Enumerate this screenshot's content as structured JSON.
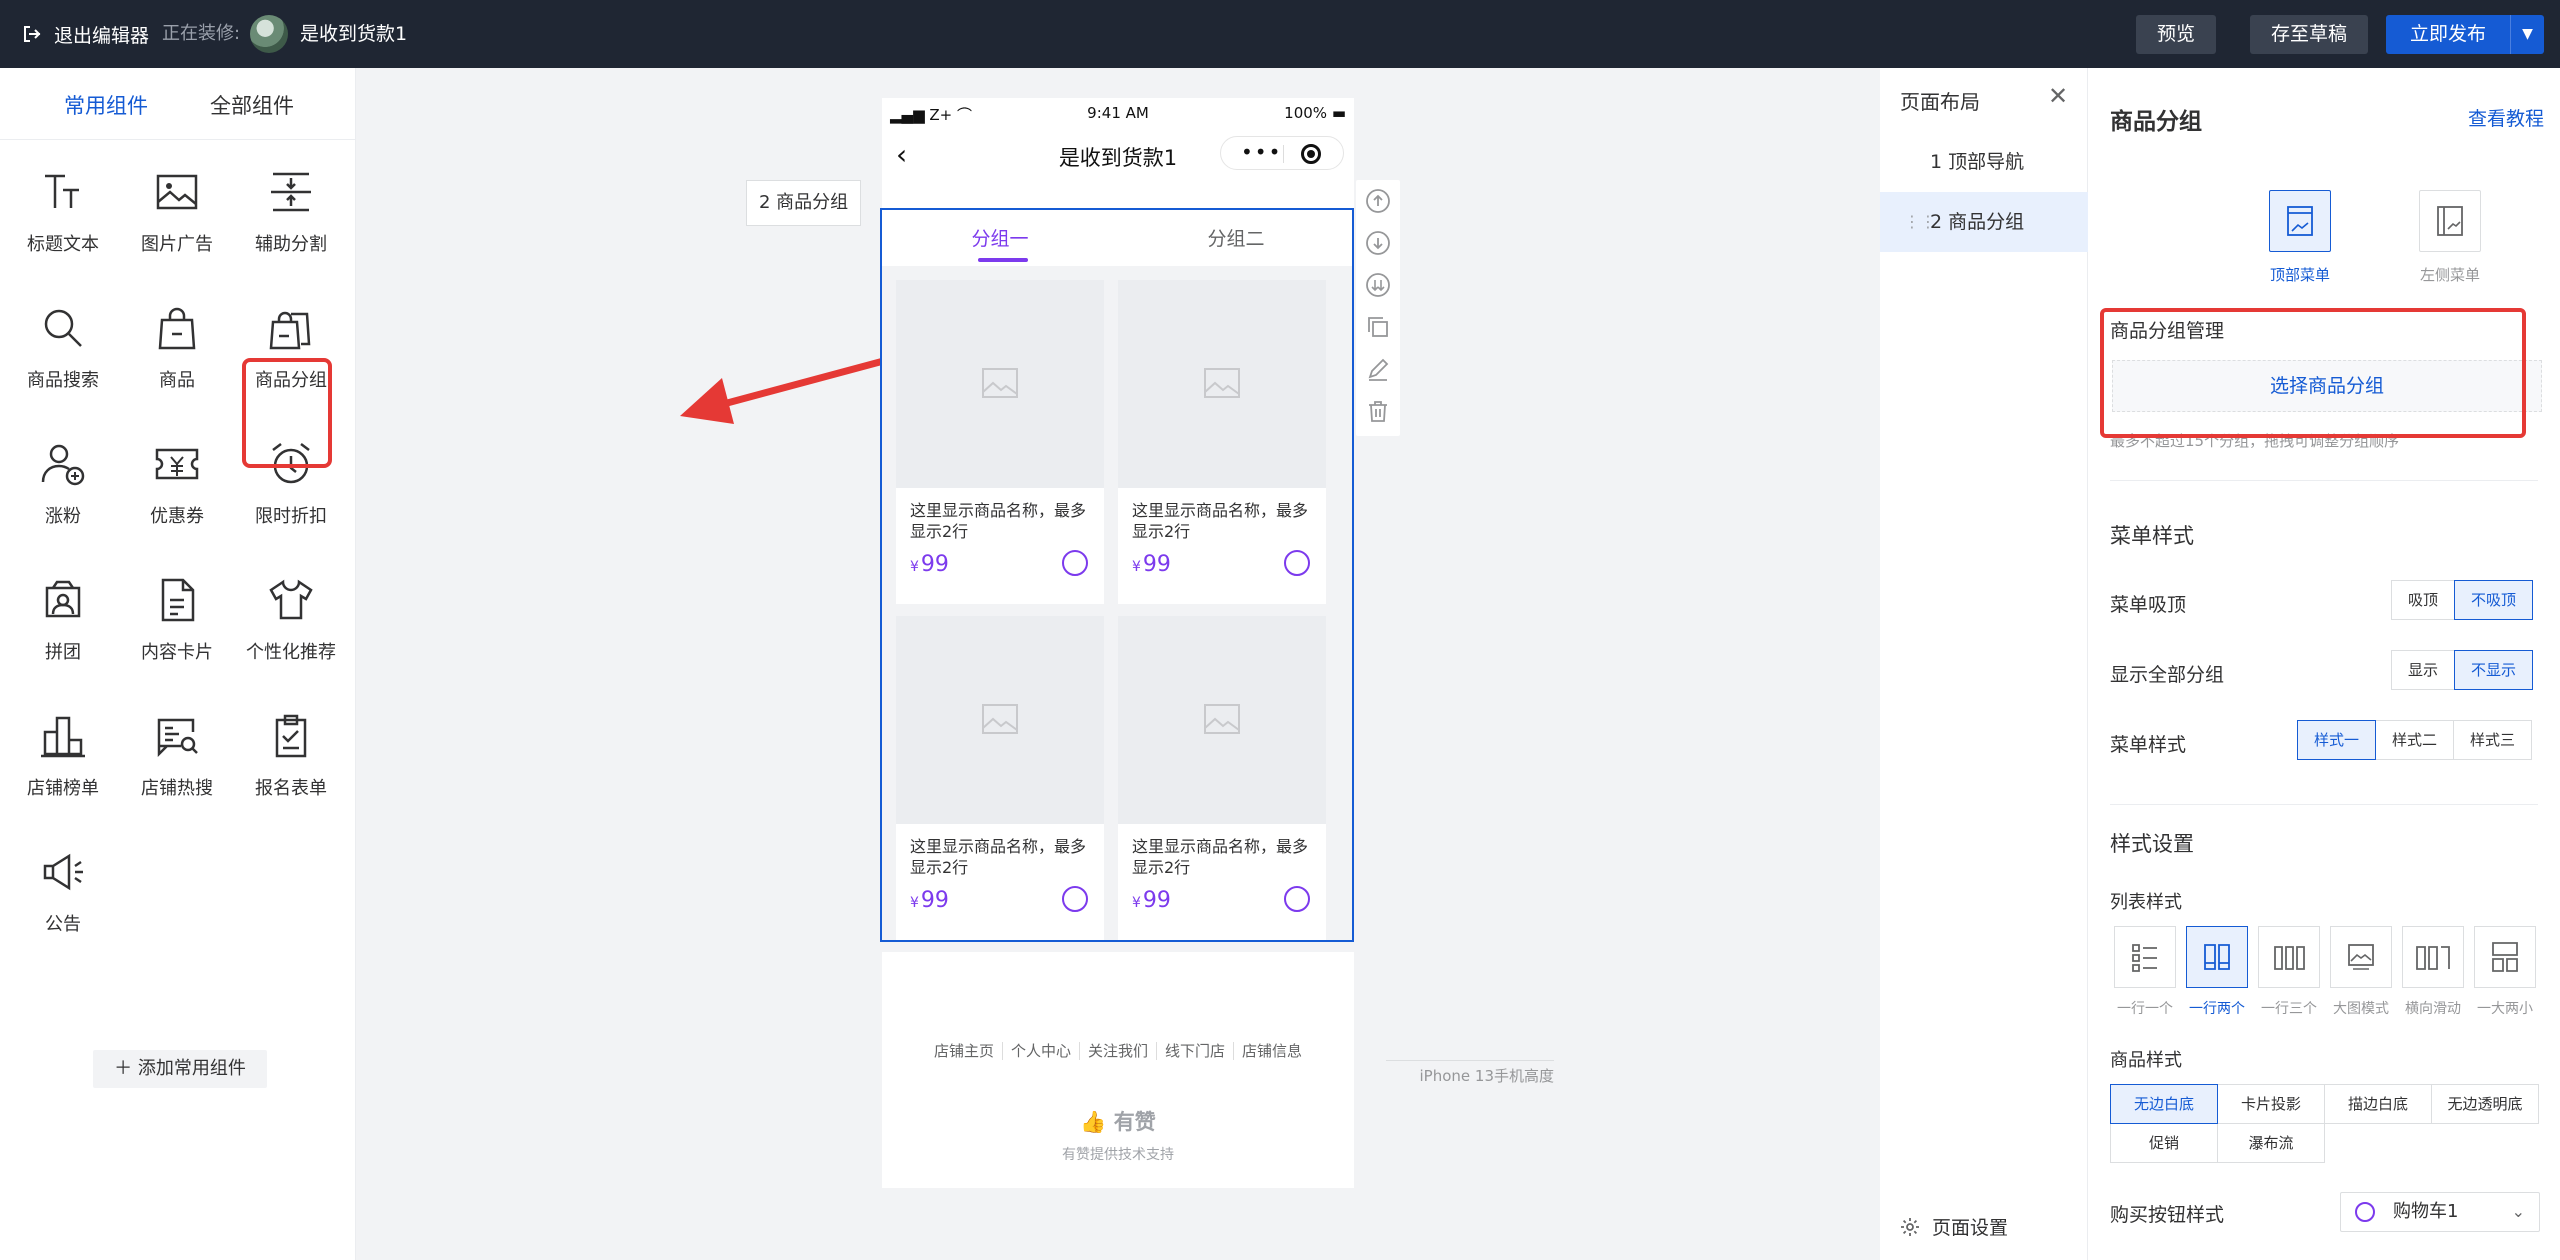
{
  "topbar": {
    "exit_label": "退出编辑器",
    "editing_label": "正在装修:",
    "page_name": "是收到货款1",
    "preview": "预览",
    "save_draft": "存至草稿",
    "publish": "立即发布"
  },
  "left_panel": {
    "tabs": [
      "常用组件",
      "全部组件"
    ],
    "components": [
      {
        "label": "标题文本",
        "icon": "title-text-icon"
      },
      {
        "label": "图片广告",
        "icon": "image-ad-icon"
      },
      {
        "label": "辅助分割",
        "icon": "divider-icon"
      },
      {
        "label": "商品搜索",
        "icon": "search-icon"
      },
      {
        "label": "商品",
        "icon": "bag-icon"
      },
      {
        "label": "商品分组",
        "icon": "goods-group-icon"
      },
      {
        "label": "涨粉",
        "icon": "add-fan-icon"
      },
      {
        "label": "优惠券",
        "icon": "coupon-icon"
      },
      {
        "label": "限时折扣",
        "icon": "alarm-clock-icon"
      },
      {
        "label": "拼团",
        "icon": "group-buy-icon"
      },
      {
        "label": "内容卡片",
        "icon": "document-icon"
      },
      {
        "label": "个性化推荐",
        "icon": "tshirt-icon"
      },
      {
        "label": "店铺榜单",
        "icon": "bar-chart-icon"
      },
      {
        "label": "店铺热搜",
        "icon": "hot-search-icon"
      },
      {
        "label": "报名表单",
        "icon": "clipboard-icon"
      },
      {
        "label": "公告",
        "icon": "megaphone-icon"
      }
    ],
    "add_common": "添加常用组件"
  },
  "canvas": {
    "component_tag": "2 商品分组",
    "status_bar": {
      "carrier": "Z+",
      "time": "9:41 AM",
      "battery": "100%"
    },
    "nav_title": "是收到货款1",
    "goods_tabs": [
      "分组一",
      "分组二"
    ],
    "products": [
      {
        "name": "这里显示商品名称，最多显示2行",
        "currency": "¥",
        "price": "99"
      },
      {
        "name": "这里显示商品名称，最多显示2行",
        "currency": "¥",
        "price": "99"
      },
      {
        "name": "这里显示商品名称，最多显示2行",
        "currency": "¥",
        "price": "99"
      },
      {
        "name": "这里显示商品名称，最多显示2行",
        "currency": "¥",
        "price": "99"
      }
    ],
    "footer_links": [
      "店铺主页",
      "个人中心",
      "关注我们",
      "线下门店",
      "店铺信息"
    ],
    "brand": "有赞",
    "support": "有赞提供技术支持",
    "device_label": "iPhone 13手机高度"
  },
  "layout_panel": {
    "title": "页面布局",
    "items": [
      "1 顶部导航",
      "2 商品分组"
    ],
    "settings": "页面设置"
  },
  "config": {
    "title": "商品分组",
    "tutorial": "查看教程",
    "menu_types": [
      "顶部菜单",
      "左侧菜单"
    ],
    "group_manage": "商品分组管理",
    "choose_group": "选择商品分组",
    "hint": "最多不超过15个分组，拖拽可调整分组顺序",
    "menu_style_section": "菜单样式",
    "sticky_label": "菜单吸顶",
    "sticky_options": [
      "吸顶",
      "不吸顶"
    ],
    "show_all_label": "显示全部分组",
    "show_all_options": [
      "显示",
      "不显示"
    ],
    "menu_style_label": "菜单样式",
    "menu_style_options": [
      "样式一",
      "样式二",
      "样式三"
    ],
    "style_section": "样式设置",
    "list_style_label": "列表样式",
    "list_styles": [
      "一行一个",
      "一行两个",
      "一行三个",
      "大图模式",
      "横向滑动",
      "一大两小"
    ],
    "goods_style_label": "商品样式",
    "goods_styles": [
      "无边白底",
      "卡片投影",
      "描边白底",
      "无边透明底",
      "促销",
      "瀑布流"
    ],
    "buy_button_label": "购买按钮样式",
    "buy_button_value": "购物车1"
  },
  "colors": {
    "brand_blue": "#155bd4",
    "accent_purple": "#7c3aed",
    "highlight_red": "#e53935",
    "topbar": "#1f2633"
  }
}
